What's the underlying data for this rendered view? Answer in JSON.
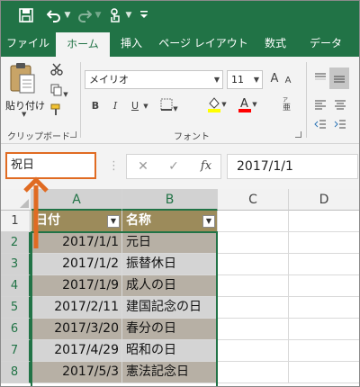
{
  "qat": {
    "save_icon": "save-icon",
    "undo_icon": "undo-icon",
    "redo_icon": "redo-icon",
    "touch_icon": "touch-mode-icon",
    "customize_icon": "customize-qat-icon"
  },
  "tabs": [
    {
      "label": "ファイル"
    },
    {
      "label": "ホーム"
    },
    {
      "label": "挿入"
    },
    {
      "label": "ページ レイアウト"
    },
    {
      "label": "数式"
    },
    {
      "label": "データ"
    }
  ],
  "ribbon": {
    "paste_label": "貼り付け",
    "clipboard_label": "クリップボード",
    "font_group_label": "フォント",
    "font_name": "メイリオ",
    "font_size": "11",
    "bold": "B",
    "italic": "I",
    "underline": "U",
    "grow_font": "A",
    "shrink_font": "A",
    "fill_color": "#ffff00",
    "font_color": "#ff0000"
  },
  "formula_bar": {
    "name_box": "祝日",
    "cancel_icon": "cancel-icon",
    "enter_icon": "enter-icon",
    "fx": "fx",
    "content": "2017/1/1"
  },
  "sheet": {
    "columns": [
      "A",
      "B",
      "C",
      "D"
    ],
    "rows": [
      "1",
      "2",
      "3",
      "4",
      "5",
      "6",
      "7",
      "8"
    ],
    "header": {
      "a": "日付",
      "b": "名称"
    },
    "data": [
      {
        "date": "2017/1/1",
        "name": "元日"
      },
      {
        "date": "2017/1/2",
        "name": "振替休日"
      },
      {
        "date": "2017/1/9",
        "name": "成人の日"
      },
      {
        "date": "2017/2/11",
        "name": "建国記念の日"
      },
      {
        "date": "2017/3/20",
        "name": "春分の日"
      },
      {
        "date": "2017/4/29",
        "name": "昭和の日"
      },
      {
        "date": "2017/5/3",
        "name": "憲法記念日"
      }
    ]
  },
  "colors": {
    "accent": "#217346",
    "highlight": "#e06b22",
    "table_header": "#9c8b5b"
  }
}
